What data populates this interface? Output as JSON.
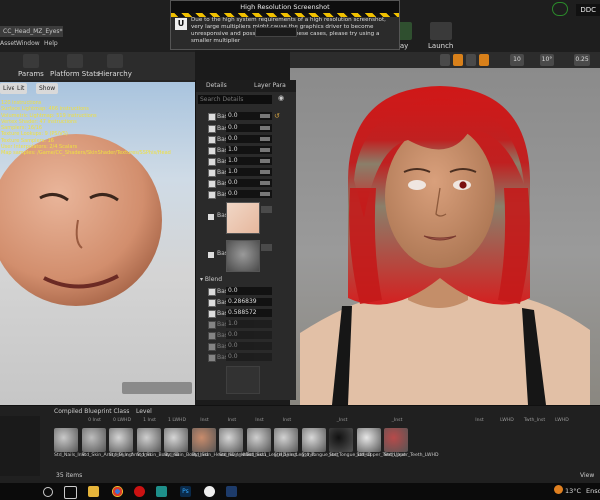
{
  "hires_dialog": {
    "title": "High Resolution Screenshot",
    "message": "Due to the high system requirements of a high resolution screenshot, very large multipliers might cause the graphics driver to become unresponsive and possibly crash. In these cases, please try using a smaller multiplier"
  },
  "left_window": {
    "tab": "CC_Head_MZ_Eyes*",
    "menu": [
      "Asset",
      "Window",
      "Help"
    ],
    "toolbar": [
      "Params",
      "Platform Stats",
      "Hierarchy"
    ],
    "viewport_buttons": [
      "Live",
      "Lit",
      "Show"
    ],
    "stats": [
      "120 instructions",
      "Surface Lightmap: 466 instructions",
      "Volumetric Lightmap: 519 instructions",
      "Vertex Shader: 47 instructions",
      "Samplers: 16/16",
      "Texture Lookups: 9 (PS/VS)",
      "Texture Samplers: 16",
      "User Interpolators: 2/4 Scalars",
      "Map samples: /Game/CC_Shaders/SkinShader/Textures/SSPhis/Head"
    ]
  },
  "details_panel": {
    "tabs": [
      "Details",
      "Layer Para"
    ],
    "search_placeholder": "Search Details",
    "param_label": "Base",
    "params": [
      "0.0",
      "0.0",
      "0.0",
      "1.0",
      "1.0",
      "1.0",
      "0.0",
      "0.0"
    ],
    "blend_header": "Blend",
    "blend_params": [
      "0.0",
      "0.286839",
      "0.588572",
      "1.0",
      "0.0",
      "0.0",
      "0.0"
    ],
    "reset_arrow": "↺"
  },
  "right_window": {
    "title": "DDC",
    "toolbar": [
      "Play",
      "Launch"
    ],
    "viewport_chips": [
      "10",
      "10°",
      "0.25"
    ]
  },
  "content_browser": {
    "tabs": [
      "Compiled Blueprint Class",
      "Level"
    ],
    "top_labels": [
      "",
      "0 Inst",
      "0 LWHD",
      "1 Inst",
      "1 LWHD",
      "Inst",
      "Inst",
      "Inst",
      "Inst",
      "",
      "_Inst",
      "",
      "_Inst",
      "",
      "",
      "Inst",
      "LWHD",
      "Twth_Inst",
      "LWHD"
    ],
    "assets": [
      {
        "name": "Std_Nails_Inst"
      },
      {
        "name": "Std_Skin_Arm_HD_Inst"
      },
      {
        "name": "Std_Skin_Arm_Inst"
      },
      {
        "name": "Std_Skin_Body_HD"
      },
      {
        "name": "Std_Skin_Body_Inst"
      },
      {
        "name": "Std_Skin_Head_HD_Inst1"
      },
      {
        "name": "Std_Skin_Head_Inst1"
      },
      {
        "name": "Std_Skin_Leg_HD_Inst"
      },
      {
        "name": "Std_Skin_Leg_Inst"
      },
      {
        "name": "Std_Tongue_Inst"
      },
      {
        "name": "Std_Tongue_LWHD"
      },
      {
        "name": "Std_Upper_Teeth_Inst"
      },
      {
        "name": "Std_Upper_Teeth_LWHD"
      }
    ],
    "items_count": "35 items",
    "view_options": "View"
  },
  "taskbar": {
    "temperature": "13°C",
    "language": "Ensol"
  }
}
